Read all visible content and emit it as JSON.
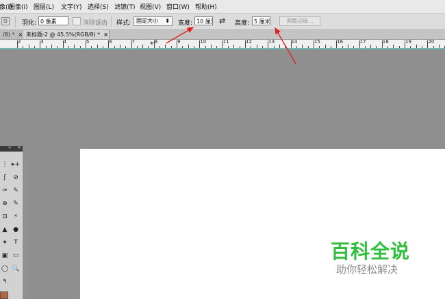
{
  "menu": [
    "像(I)",
    "图像(I)",
    "图层(L)",
    "文字(Y)",
    "选择(S)",
    "滤镜(T)",
    "视图(V)",
    "窗口(W)",
    "帮助(H)"
  ],
  "options": {
    "feather_label": "羽化:",
    "feather_value": "0 像素",
    "antialias_label": "消除锯齿",
    "style_label": "样式:",
    "style_value": "固定大小",
    "width_label": "宽度:",
    "width_value": "10 厘米",
    "height_label": "高度:",
    "height_value": "5 厘米",
    "refine_label": "调整边缘..."
  },
  "tabs": [
    {
      "label": "/8) *"
    },
    {
      "label": "未标题-2 @ 45.5%(RGB/8) *"
    }
  ],
  "ruler_labels": [
    "2",
    "3",
    "4",
    "5",
    "6",
    "7",
    "8",
    "9",
    "10",
    "11",
    "12",
    "13",
    "14",
    "15",
    "16",
    "17",
    "18",
    "19",
    "20"
  ],
  "toolpanel": {
    "header_left": "«",
    "header_right": "×",
    "tools": [
      "⋮",
      "▸+",
      "ʃ",
      "⊘",
      "✑",
      "✎",
      "⊕",
      "✎",
      "⊡",
      "⚡",
      "▲",
      "●",
      "✦",
      "T",
      "▣",
      "▭",
      "◯",
      "🔍",
      "↰"
    ]
  },
  "watermark": {
    "title": "百科全说",
    "subtitle": "助你轻松解决"
  },
  "colors": {
    "foreground_swatch": "#b2663f",
    "annotation_arrow": "#e02020",
    "watermark_green": "#2fbf3c"
  }
}
